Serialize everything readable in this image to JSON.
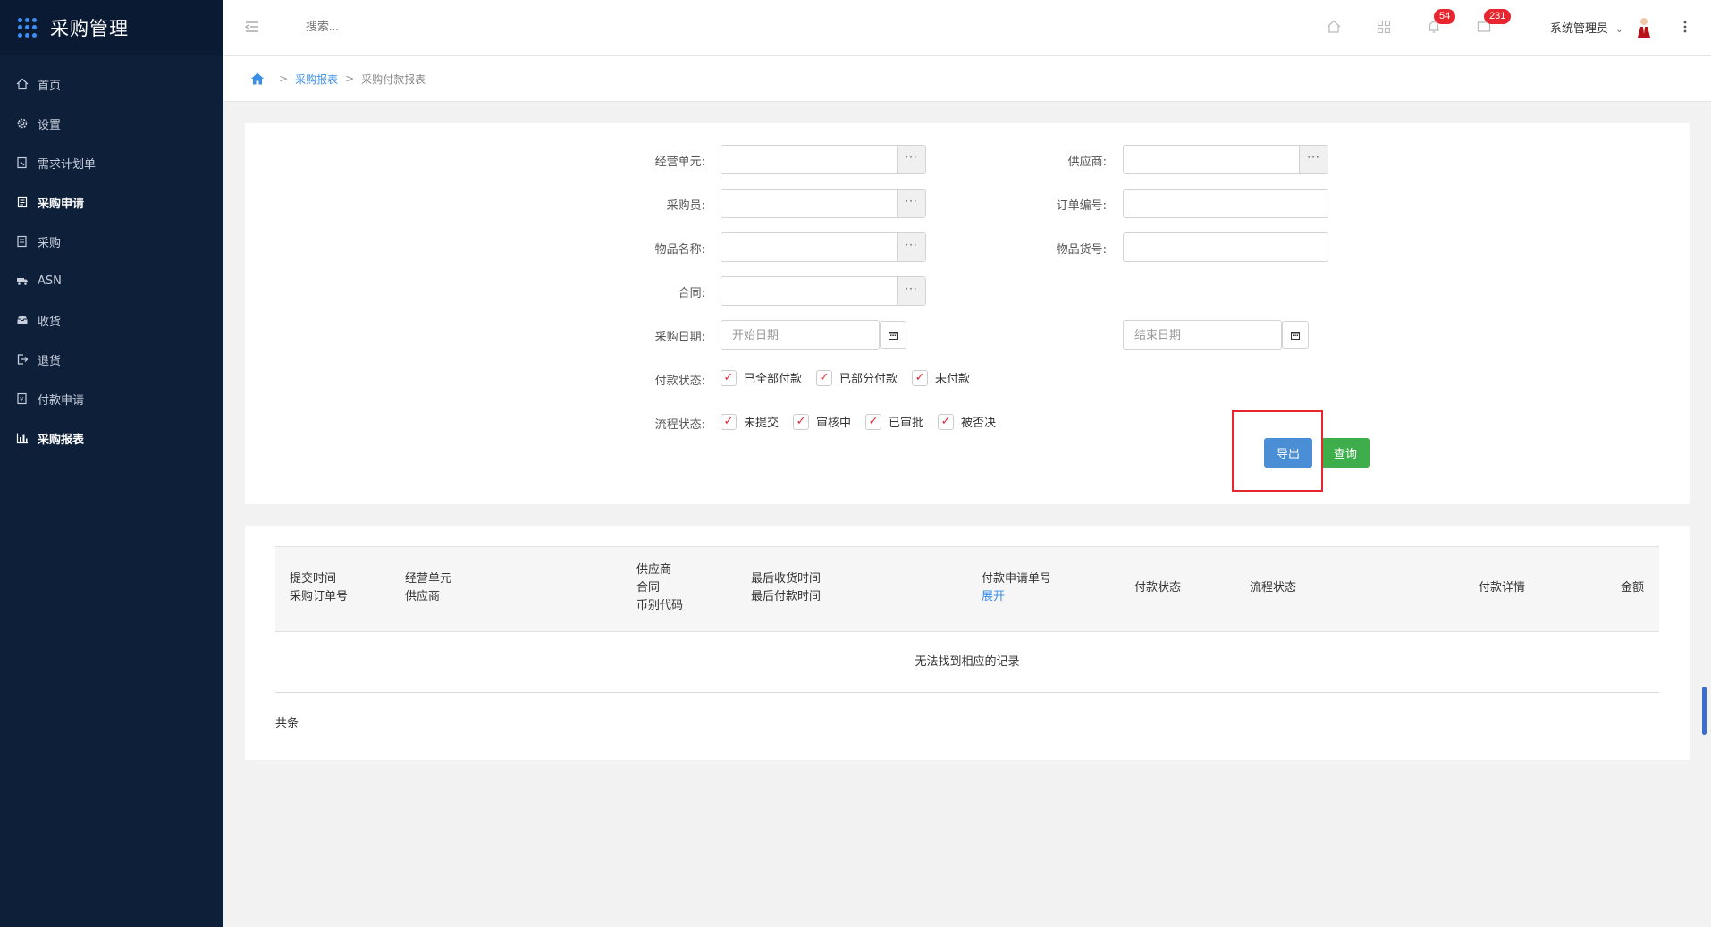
{
  "app": {
    "title": "采购管理"
  },
  "sidebar": {
    "items": [
      {
        "label": "首页",
        "icon": "home-icon"
      },
      {
        "label": "设置",
        "icon": "gear-icon"
      },
      {
        "label": "需求计划单",
        "icon": "document-edit-icon"
      },
      {
        "label": "采购申请",
        "icon": "document-icon"
      },
      {
        "label": "采购",
        "icon": "list-icon"
      },
      {
        "label": "ASN",
        "icon": "truck-icon"
      },
      {
        "label": "收货",
        "icon": "inbox-icon"
      },
      {
        "label": "退货",
        "icon": "exit-icon"
      },
      {
        "label": "付款申请",
        "icon": "payment-doc-icon"
      },
      {
        "label": "采购报表",
        "icon": "bar-chart-icon"
      }
    ]
  },
  "header": {
    "search_placeholder": "搜索...",
    "notifications_count": "54",
    "messages_count": "231",
    "user_name": "系统管理员"
  },
  "breadcrumb": {
    "parent": "采购报表",
    "current": "采购付款报表"
  },
  "filter": {
    "business_unit_label": "经营单元:",
    "supplier_label": "供应商:",
    "purchaser_label": "采购员:",
    "order_no_label": "订单编号:",
    "item_name_label": "物品名称:",
    "item_code_label": "物品货号:",
    "contract_label": "合同:",
    "purchase_date_label": "采购日期:",
    "start_date_placeholder": "开始日期",
    "end_date_placeholder": "结束日期",
    "payment_status_label": "付款状态:",
    "payment_status_options": [
      "已全部付款",
      "已部分付款",
      "未付款"
    ],
    "flow_status_label": "流程状态:",
    "flow_status_options": [
      "未提交",
      "审核中",
      "已审批",
      "被否决"
    ],
    "picker_button": "···",
    "export_button": "导出",
    "query_button": "查询"
  },
  "table": {
    "columns": {
      "c1_line1": "提交时间",
      "c1_line2": "采购订单号",
      "c2_line1": "经营单元",
      "c2_line2": "供应商",
      "c3_line1": "供应商",
      "c3_line2": "合同",
      "c3_line3": "币别代码",
      "c4_line1": "最后收货时间",
      "c4_line2": "最后付款时间",
      "c5_line1": "付款申请单号",
      "c5_link": "展开",
      "c6": "付款状态",
      "c7": "流程状态",
      "c8": "付款详情",
      "c9": "金额"
    },
    "empty_message": "无法找到相应的记录",
    "total_label": "共条"
  },
  "colors": {
    "sidebar_bg": "#0e1f3a",
    "export_button": "#4a8fd6",
    "query_button": "#3dae4b",
    "badge": "#e8262f",
    "highlight": "#e8262f"
  }
}
